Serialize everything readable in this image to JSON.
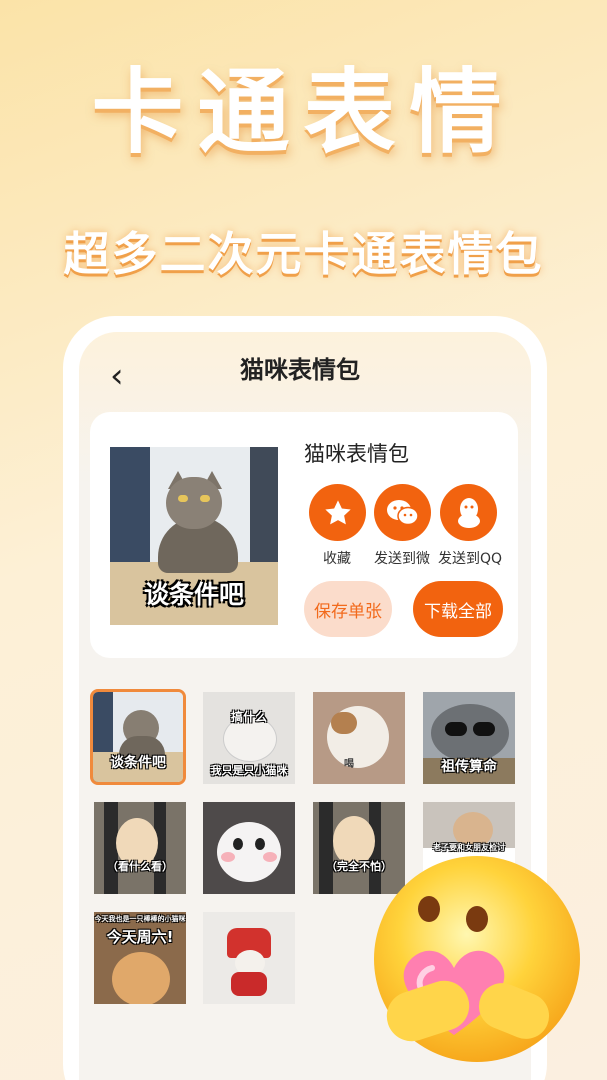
{
  "hero": {
    "title": "卡通表情",
    "subtitle": "超多二次元卡通表情包"
  },
  "nav": {
    "back_icon": "‹",
    "title": "猫咪表情包"
  },
  "pack": {
    "cover_caption": "谈条件吧",
    "name": "猫咪表情包",
    "actions": [
      {
        "icon": "star-icon",
        "label": "收藏"
      },
      {
        "icon": "wechat-icon",
        "label": "发送到微"
      },
      {
        "icon": "qq-icon",
        "label": "发送到QQ"
      }
    ],
    "save_single_label": "保存单张",
    "download_all_label": "下载全部"
  },
  "grid": [
    {
      "caption": "谈条件吧",
      "selected": true
    },
    {
      "caption_top": "搞什么",
      "caption": "我只是只小猫咪"
    },
    {
      "caption": "喝"
    },
    {
      "caption": "祖传算命"
    },
    {
      "caption": "（看什么看）"
    },
    {
      "caption": ""
    },
    {
      "caption": "（完全不怕）"
    },
    {
      "caption": "老子要和女朋友检讨"
    },
    {
      "caption_top": "今天我也是一只棒棒的小猫咪",
      "caption": "今天周六!"
    },
    {
      "caption": ""
    }
  ],
  "colors": {
    "accent": "#f2630f",
    "save_bg": "#fbdccb",
    "hero_shadow": "#f2b062"
  }
}
